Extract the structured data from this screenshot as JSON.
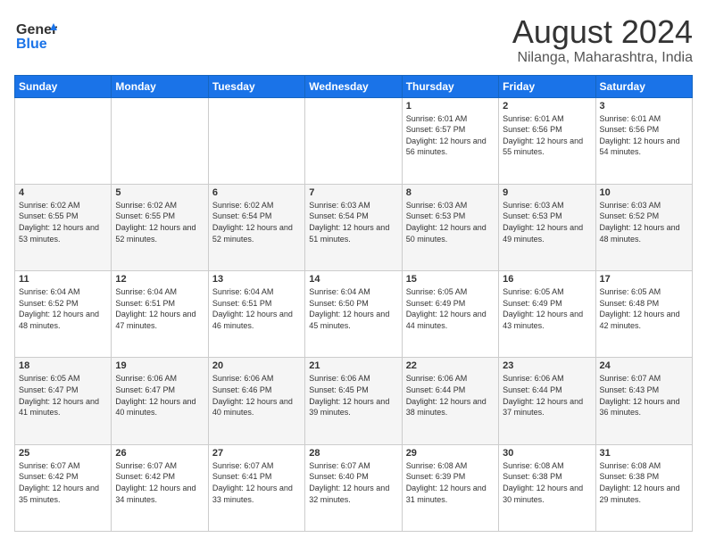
{
  "header": {
    "logo_line1": "General",
    "logo_line2": "Blue",
    "month": "August 2024",
    "location": "Nilanga, Maharashtra, India"
  },
  "weekdays": [
    "Sunday",
    "Monday",
    "Tuesday",
    "Wednesday",
    "Thursday",
    "Friday",
    "Saturday"
  ],
  "weeks": [
    [
      {
        "day": "",
        "empty": true
      },
      {
        "day": "",
        "empty": true
      },
      {
        "day": "",
        "empty": true
      },
      {
        "day": "",
        "empty": true
      },
      {
        "day": "1",
        "sunrise": "6:01 AM",
        "sunset": "6:57 PM",
        "daylight": "12 hours and 56 minutes."
      },
      {
        "day": "2",
        "sunrise": "6:01 AM",
        "sunset": "6:56 PM",
        "daylight": "12 hours and 55 minutes."
      },
      {
        "day": "3",
        "sunrise": "6:01 AM",
        "sunset": "6:56 PM",
        "daylight": "12 hours and 54 minutes."
      }
    ],
    [
      {
        "day": "4",
        "sunrise": "6:02 AM",
        "sunset": "6:55 PM",
        "daylight": "12 hours and 53 minutes."
      },
      {
        "day": "5",
        "sunrise": "6:02 AM",
        "sunset": "6:55 PM",
        "daylight": "12 hours and 52 minutes."
      },
      {
        "day": "6",
        "sunrise": "6:02 AM",
        "sunset": "6:54 PM",
        "daylight": "12 hours and 52 minutes."
      },
      {
        "day": "7",
        "sunrise": "6:03 AM",
        "sunset": "6:54 PM",
        "daylight": "12 hours and 51 minutes."
      },
      {
        "day": "8",
        "sunrise": "6:03 AM",
        "sunset": "6:53 PM",
        "daylight": "12 hours and 50 minutes."
      },
      {
        "day": "9",
        "sunrise": "6:03 AM",
        "sunset": "6:53 PM",
        "daylight": "12 hours and 49 minutes."
      },
      {
        "day": "10",
        "sunrise": "6:03 AM",
        "sunset": "6:52 PM",
        "daylight": "12 hours and 48 minutes."
      }
    ],
    [
      {
        "day": "11",
        "sunrise": "6:04 AM",
        "sunset": "6:52 PM",
        "daylight": "12 hours and 48 minutes."
      },
      {
        "day": "12",
        "sunrise": "6:04 AM",
        "sunset": "6:51 PM",
        "daylight": "12 hours and 47 minutes."
      },
      {
        "day": "13",
        "sunrise": "6:04 AM",
        "sunset": "6:51 PM",
        "daylight": "12 hours and 46 minutes."
      },
      {
        "day": "14",
        "sunrise": "6:04 AM",
        "sunset": "6:50 PM",
        "daylight": "12 hours and 45 minutes."
      },
      {
        "day": "15",
        "sunrise": "6:05 AM",
        "sunset": "6:49 PM",
        "daylight": "12 hours and 44 minutes."
      },
      {
        "day": "16",
        "sunrise": "6:05 AM",
        "sunset": "6:49 PM",
        "daylight": "12 hours and 43 minutes."
      },
      {
        "day": "17",
        "sunrise": "6:05 AM",
        "sunset": "6:48 PM",
        "daylight": "12 hours and 42 minutes."
      }
    ],
    [
      {
        "day": "18",
        "sunrise": "6:05 AM",
        "sunset": "6:47 PM",
        "daylight": "12 hours and 41 minutes."
      },
      {
        "day": "19",
        "sunrise": "6:06 AM",
        "sunset": "6:47 PM",
        "daylight": "12 hours and 40 minutes."
      },
      {
        "day": "20",
        "sunrise": "6:06 AM",
        "sunset": "6:46 PM",
        "daylight": "12 hours and 40 minutes."
      },
      {
        "day": "21",
        "sunrise": "6:06 AM",
        "sunset": "6:45 PM",
        "daylight": "12 hours and 39 minutes."
      },
      {
        "day": "22",
        "sunrise": "6:06 AM",
        "sunset": "6:44 PM",
        "daylight": "12 hours and 38 minutes."
      },
      {
        "day": "23",
        "sunrise": "6:06 AM",
        "sunset": "6:44 PM",
        "daylight": "12 hours and 37 minutes."
      },
      {
        "day": "24",
        "sunrise": "6:07 AM",
        "sunset": "6:43 PM",
        "daylight": "12 hours and 36 minutes."
      }
    ],
    [
      {
        "day": "25",
        "sunrise": "6:07 AM",
        "sunset": "6:42 PM",
        "daylight": "12 hours and 35 minutes."
      },
      {
        "day": "26",
        "sunrise": "6:07 AM",
        "sunset": "6:42 PM",
        "daylight": "12 hours and 34 minutes."
      },
      {
        "day": "27",
        "sunrise": "6:07 AM",
        "sunset": "6:41 PM",
        "daylight": "12 hours and 33 minutes."
      },
      {
        "day": "28",
        "sunrise": "6:07 AM",
        "sunset": "6:40 PM",
        "daylight": "12 hours and 32 minutes."
      },
      {
        "day": "29",
        "sunrise": "6:08 AM",
        "sunset": "6:39 PM",
        "daylight": "12 hours and 31 minutes."
      },
      {
        "day": "30",
        "sunrise": "6:08 AM",
        "sunset": "6:38 PM",
        "daylight": "12 hours and 30 minutes."
      },
      {
        "day": "31",
        "sunrise": "6:08 AM",
        "sunset": "6:38 PM",
        "daylight": "12 hours and 29 minutes."
      }
    ]
  ]
}
